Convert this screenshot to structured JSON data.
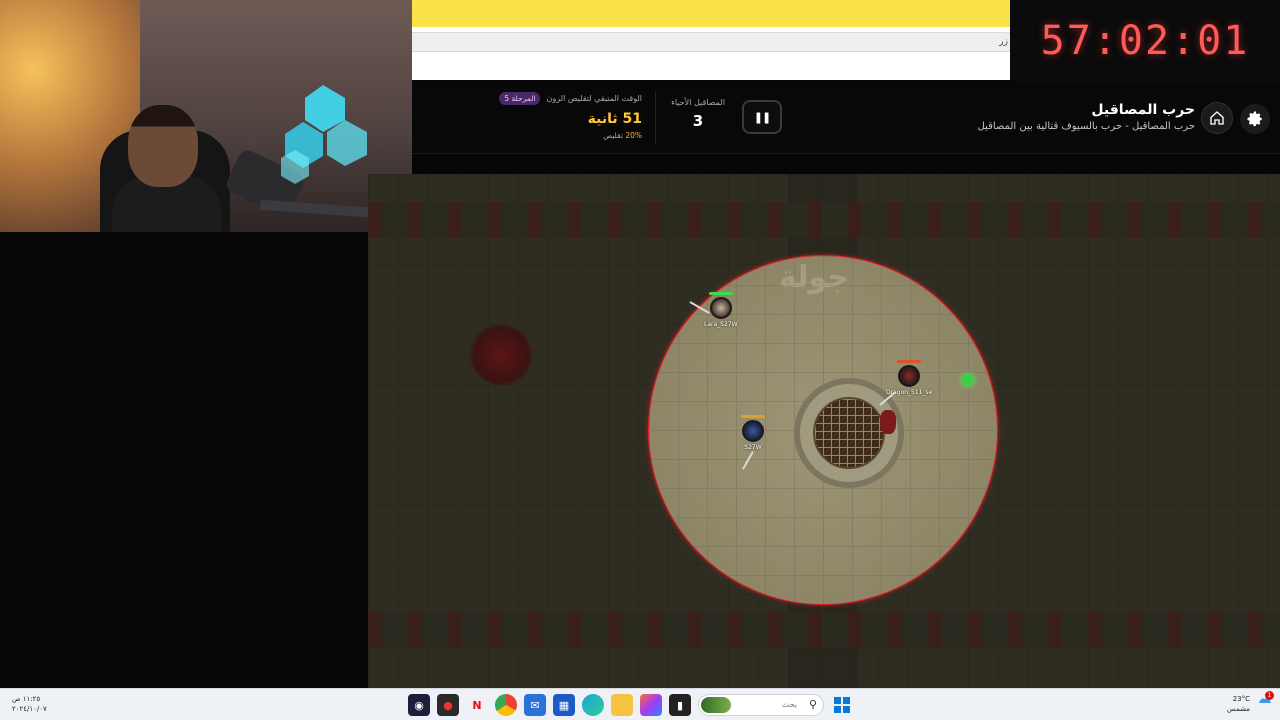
{
  "countdown": "57:02:01",
  "browser": {
    "address_fragment": "زر"
  },
  "game": {
    "title": "حرب المصاقيل",
    "subtitle": "حرب المصاقيل - حرب بالسيوف قتالية بين المصاقيل",
    "alive_label": "المصاقيل الأحياء",
    "alive_count": "3",
    "zone_label": "الوقت المتبقي لتقليص الزون",
    "stage_badge": "المرحلة 5",
    "zone_seconds": "51 ثانية",
    "shrink_percent": "20%",
    "shrink_label": "تقليص",
    "ghost_text": "جولة",
    "players": [
      {
        "name": "Lara_S27W",
        "hp_color": "#3ddc4a"
      },
      {
        "name": "Dragon_511_se",
        "hp_color": "#e0502a"
      },
      {
        "name": "S27W",
        "hp_color": "#e0a020"
      }
    ]
  },
  "taskbar": {
    "time": "١١:٢٥ ص",
    "date": "٢٠٢٤/١٠/٠٧",
    "search_placeholder": "بحث",
    "temperature": "23°C",
    "weather_desc": "مشمس",
    "notification_count": "1"
  },
  "icons": [
    "settings-icon",
    "home-icon",
    "pause-icon",
    "search-icon",
    "windows-icon"
  ],
  "colors": {
    "timer_red": "#ff5a58",
    "zone_yellow": "#ffc73a",
    "badge_purple": "#4a2a66",
    "zone_border": "#e0202a"
  }
}
